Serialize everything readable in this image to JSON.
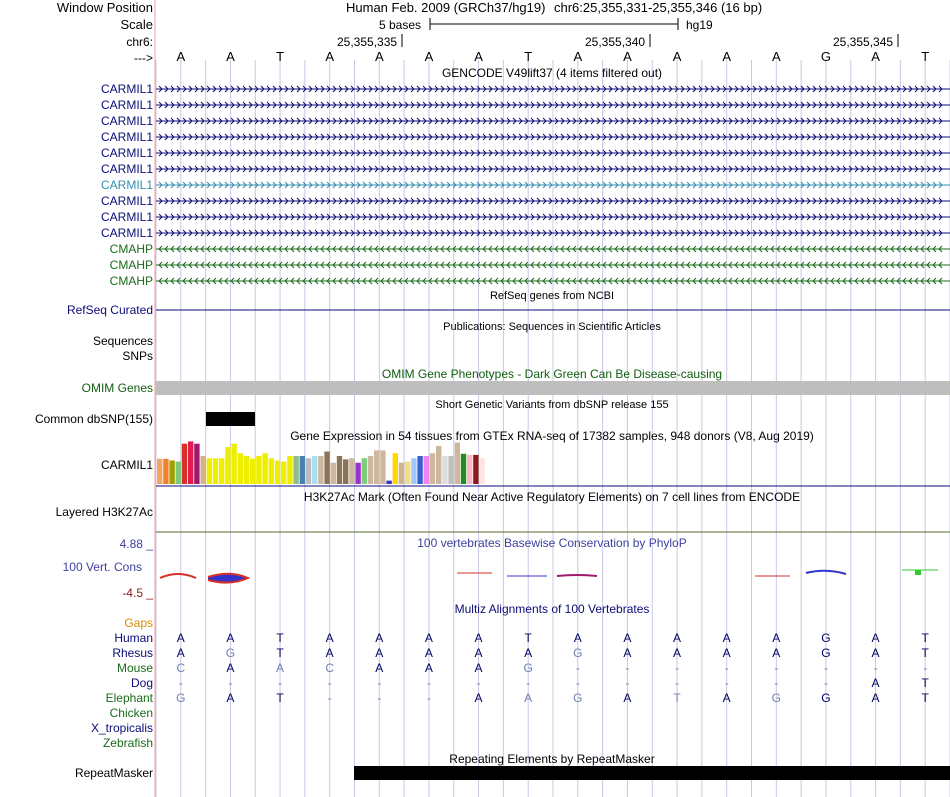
{
  "header": {
    "window_position_label": "Window Position",
    "assembly_text": "Human Feb. 2009 (GRCh37/hg19)",
    "position_text": "chr6:25,355,331-25,355,346 (16 bp)",
    "scale_label": "Scale",
    "scale_bar_text": "5 bases",
    "scale_db_text": "hg19",
    "chrom_label": "chr6:",
    "strand_label": "--->",
    "ticks": [
      "25,355,335",
      "25,355,340",
      "25,355,345"
    ]
  },
  "sequence": [
    "A",
    "A",
    "T",
    "A",
    "A",
    "A",
    "A",
    "T",
    "A",
    "A",
    "A",
    "A",
    "A",
    "G",
    "A",
    "T"
  ],
  "gencode": {
    "title": "GENCODE V49lift37 (4 items filtered out)",
    "rows": [
      {
        "label": "CARMIL1",
        "color": "#0c0c78",
        "strand": "+"
      },
      {
        "label": "CARMIL1",
        "color": "#0c0c78",
        "strand": "+"
      },
      {
        "label": "CARMIL1",
        "color": "#0c0c78",
        "strand": "+"
      },
      {
        "label": "CARMIL1",
        "color": "#0c0c78",
        "strand": "+"
      },
      {
        "label": "CARMIL1",
        "color": "#0c0c78",
        "strand": "+"
      },
      {
        "label": "CARMIL1",
        "color": "#0c0c78",
        "strand": "+"
      },
      {
        "label": "CARMIL1",
        "color": "#2f8fb0",
        "strand": "+"
      },
      {
        "label": "CARMIL1",
        "color": "#0c0c78",
        "strand": "+"
      },
      {
        "label": "CARMIL1",
        "color": "#0c0c78",
        "strand": "+"
      },
      {
        "label": "CARMIL1",
        "color": "#0c0c78",
        "strand": "+"
      },
      {
        "label": "CMAHP",
        "color": "#1a6b1a",
        "strand": "-"
      },
      {
        "label": "CMAHP",
        "color": "#1a6b1a",
        "strand": "-"
      },
      {
        "label": "CMAHP",
        "color": "#1a6b1a",
        "strand": "-"
      }
    ]
  },
  "refseq": {
    "title": "RefSeq genes from NCBI",
    "label": "RefSeq Curated",
    "color": "#0c0c78"
  },
  "publications": {
    "title": "Publications: Sequences in Scientific Articles",
    "label_sequences": "Sequences",
    "label_snps": "SNPs"
  },
  "omim": {
    "title": "OMIM Gene Phenotypes - Dark Green Can Be Disease-causing",
    "label": "OMIM Genes",
    "color": "#0f5e0f",
    "bar_color": "#bebebe"
  },
  "dbsnp": {
    "title": "Short Genetic Variants from dbSNP release 155",
    "label": "Common dbSNP(155)"
  },
  "gtex": {
    "title": "Gene Expression in 54 tissues from GTEx RNA-seq of 17382 samples, 948 donors (V8, Aug 2019)",
    "label": "CARMIL1",
    "bars": [
      {
        "h": 0.45,
        "c": "#f4a460"
      },
      {
        "h": 0.45,
        "c": "#f08030"
      },
      {
        "h": 0.42,
        "c": "#a0a000"
      },
      {
        "h": 0.4,
        "c": "#7ec87e"
      },
      {
        "h": 0.72,
        "c": "#d73027"
      },
      {
        "h": 0.76,
        "c": "#e51a4c"
      },
      {
        "h": 0.72,
        "c": "#a0196e"
      },
      {
        "h": 0.5,
        "c": "#d2b48c"
      },
      {
        "h": 0.46,
        "c": "#eeee00"
      },
      {
        "h": 0.46,
        "c": "#eeee00"
      },
      {
        "h": 0.46,
        "c": "#eeee00"
      },
      {
        "h": 0.66,
        "c": "#eeee00"
      },
      {
        "h": 0.72,
        "c": "#eeee00"
      },
      {
        "h": 0.55,
        "c": "#eeee00"
      },
      {
        "h": 0.5,
        "c": "#eeee00"
      },
      {
        "h": 0.45,
        "c": "#eeee00"
      },
      {
        "h": 0.5,
        "c": "#eeee00"
      },
      {
        "h": 0.55,
        "c": "#eeee00"
      },
      {
        "h": 0.46,
        "c": "#eeee00"
      },
      {
        "h": 0.42,
        "c": "#eeee00"
      },
      {
        "h": 0.4,
        "c": "#eeee00"
      },
      {
        "h": 0.5,
        "c": "#eeee00"
      },
      {
        "h": 0.5,
        "c": "#8fbc8f"
      },
      {
        "h": 0.5,
        "c": "#4682b4"
      },
      {
        "h": 0.46,
        "c": "#bbbbbb"
      },
      {
        "h": 0.5,
        "c": "#aaddee"
      },
      {
        "h": 0.5,
        "c": "#cdb79e"
      },
      {
        "h": 0.58,
        "c": "#8b7355"
      },
      {
        "h": 0.38,
        "c": "#cdb79e"
      },
      {
        "h": 0.5,
        "c": "#8b7355"
      },
      {
        "h": 0.44,
        "c": "#8b7355"
      },
      {
        "h": 0.46,
        "c": "#cdb79e"
      },
      {
        "h": 0.38,
        "c": "#9a32cd"
      },
      {
        "h": 0.46,
        "c": "#7ccd7c"
      },
      {
        "h": 0.5,
        "c": "#cdb79e"
      },
      {
        "h": 0.6,
        "c": "#cdb79e"
      },
      {
        "h": 0.6,
        "c": "#cdb79e"
      },
      {
        "h": 0.06,
        "c": "#3333cc"
      },
      {
        "h": 0.55,
        "c": "#ffd700"
      },
      {
        "h": 0.38,
        "c": "#d2b48c"
      },
      {
        "h": 0.4,
        "c": "#eedd82"
      },
      {
        "h": 0.46,
        "c": "#a0c8ff"
      },
      {
        "h": 0.5,
        "c": "#3a5fcd"
      },
      {
        "h": 0.5,
        "c": "#ee82ee"
      },
      {
        "h": 0.55,
        "c": "#cdb79e"
      },
      {
        "h": 0.68,
        "c": "#cdb79e"
      },
      {
        "h": 0.5,
        "c": "#dddddd"
      },
      {
        "h": 0.5,
        "c": "#c0c0c0"
      },
      {
        "h": 0.74,
        "c": "#cdb79e"
      },
      {
        "h": 0.54,
        "c": "#228b22"
      },
      {
        "h": 0.52,
        "c": "#ffb6c1"
      },
      {
        "h": 0.52,
        "c": "#8b1a1a"
      },
      {
        "h": 0.46,
        "c": "#ffe4e1"
      },
      {
        "h": 0.0,
        "c": "#ffffff"
      }
    ]
  },
  "h3k27ac": {
    "title": "H3K27Ac Mark (Often Found Near Active Regulatory Elements) on 7 cell lines from ENCODE",
    "label": "Layered H3K27Ac"
  },
  "phylop": {
    "title": "100 vertebrates Basewise Conservation by PhyloP",
    "label": "100 Vert. Cons",
    "max": "4.88 _",
    "min": "-4.5 _",
    "color": "#3f3f9f",
    "max_color": "#3f3f9f",
    "min_color": "#8b1a1a"
  },
  "multiz": {
    "title": "Multiz Alignments of 100 Vertebrates",
    "gaps_label": "Gaps",
    "gaps_color": "#d98c00",
    "species": [
      {
        "name": "Human",
        "color": "#0c0c78",
        "bases": [
          "A",
          "A",
          "T",
          "A",
          "A",
          "A",
          "A",
          "T",
          "A",
          "A",
          "A",
          "A",
          "A",
          "G",
          "A",
          "T"
        ],
        "match": [
          1,
          1,
          1,
          1,
          1,
          1,
          1,
          1,
          1,
          1,
          1,
          1,
          1,
          1,
          1,
          1
        ]
      },
      {
        "name": "Rhesus",
        "color": "#0c0c78",
        "bases": [
          "A",
          "G",
          "T",
          "A",
          "A",
          "A",
          "A",
          "A",
          "G",
          "A",
          "A",
          "A",
          "A",
          "G",
          "A",
          "T"
        ],
        "match": [
          1,
          0,
          1,
          1,
          1,
          1,
          1,
          1,
          0,
          1,
          1,
          1,
          1,
          1,
          1,
          1
        ]
      },
      {
        "name": "Mouse",
        "color": "#1a6b1a",
        "bases": [
          "C",
          "A",
          "A",
          "C",
          "A",
          "A",
          "A",
          "G",
          "-",
          "-",
          "-",
          "-",
          "-",
          "-",
          "-",
          "-"
        ],
        "match": [
          0,
          1,
          0,
          0,
          1,
          1,
          1,
          0,
          0,
          0,
          0,
          0,
          0,
          0,
          0,
          0
        ]
      },
      {
        "name": "Dog",
        "color": "#0c0c78",
        "bases": [
          "-",
          "-",
          "-",
          "-",
          "-",
          "-",
          "-",
          "-",
          "-",
          "-",
          "-",
          "-",
          "-",
          "-",
          "A",
          "T"
        ],
        "match": [
          0,
          0,
          0,
          0,
          0,
          0,
          0,
          0,
          0,
          0,
          0,
          0,
          0,
          0,
          1,
          1
        ]
      },
      {
        "name": "Elephant",
        "color": "#1a6b1a",
        "bases": [
          "G",
          "A",
          "T",
          "-",
          "-",
          "-",
          "A",
          "A",
          "G",
          "A",
          "T",
          "A",
          "G",
          "G",
          "A",
          "T"
        ],
        "match": [
          0,
          1,
          1,
          0,
          0,
          0,
          1,
          0,
          0,
          1,
          0,
          1,
          0,
          1,
          1,
          1
        ]
      },
      {
        "name": "Chicken",
        "color": "#1a6b1a",
        "bases": [],
        "match": []
      },
      {
        "name": "X_tropicalis",
        "color": "#0c0c78",
        "bases": [],
        "match": []
      },
      {
        "name": "Zebrafish",
        "color": "#1a6b1a",
        "bases": [],
        "match": []
      }
    ]
  },
  "repeatmasker": {
    "title": "Repeating Elements by RepeatMasker",
    "label": "RepeatMasker"
  },
  "colors": {
    "grid": "#c8c8e6",
    "divider": "#f0a0a0",
    "match_base": "#000060",
    "mismatch_base": "#7080b0"
  }
}
